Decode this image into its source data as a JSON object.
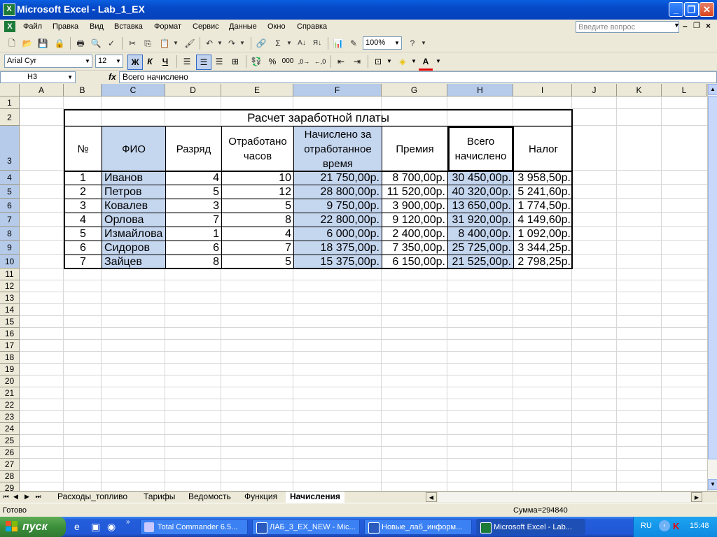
{
  "window": {
    "title": "Microsoft Excel - Lab_1_EX"
  },
  "menu": {
    "items": [
      "Файл",
      "Правка",
      "Вид",
      "Вставка",
      "Формат",
      "Сервис",
      "Данные",
      "Окно",
      "Справка"
    ],
    "ask_placeholder": "Введите вопрос"
  },
  "toolbar": {
    "zoom": "100%"
  },
  "format_toolbar": {
    "font": "Arial Cyr",
    "size": "12",
    "bold": "Ж",
    "italic": "К",
    "underline": "Ч",
    "thousands": "000"
  },
  "formula_bar": {
    "cell_ref": "H3",
    "fx": "fx",
    "content": "Всего начислено"
  },
  "columns": [
    "A",
    "B",
    "C",
    "D",
    "E",
    "F",
    "G",
    "H",
    "I",
    "J",
    "K",
    "L"
  ],
  "rows": [
    "1",
    "2",
    "3",
    "4",
    "5",
    "6",
    "7",
    "8",
    "9",
    "10",
    "11",
    "12",
    "13",
    "14",
    "15",
    "16",
    "17",
    "18",
    "19",
    "20",
    "21",
    "22",
    "23",
    "24",
    "25",
    "26",
    "27",
    "28",
    "29"
  ],
  "sheet": {
    "title": "Расчет заработной платы",
    "headers": {
      "num": "№",
      "fio": "ФИО",
      "razryad": "Разряд",
      "hours": "Отработано часов",
      "accrued": "Начислено за отработанное время",
      "bonus": "Премия",
      "total": "Всего начислено",
      "tax": "Налог"
    },
    "records": [
      {
        "n": "1",
        "name": "Иванов",
        "grade": "4",
        "hours": "10",
        "accrued": "21 750,00р.",
        "bonus": "8 700,00р.",
        "total": "30 450,00р.",
        "tax": "3 958,50р."
      },
      {
        "n": "2",
        "name": "Петров",
        "grade": "5",
        "hours": "12",
        "accrued": "28 800,00р.",
        "bonus": "11 520,00р.",
        "total": "40 320,00р.",
        "tax": "5 241,60р."
      },
      {
        "n": "3",
        "name": "Ковалев",
        "grade": "3",
        "hours": "5",
        "accrued": "9 750,00р.",
        "bonus": "3 900,00р.",
        "total": "13 650,00р.",
        "tax": "1 774,50р."
      },
      {
        "n": "4",
        "name": "Орлова",
        "grade": "7",
        "hours": "8",
        "accrued": "22 800,00р.",
        "bonus": "9 120,00р.",
        "total": "31 920,00р.",
        "tax": "4 149,60р."
      },
      {
        "n": "5",
        "name": "Измайлова",
        "grade": "1",
        "hours": "4",
        "accrued": "6 000,00р.",
        "bonus": "2 400,00р.",
        "total": "8 400,00р.",
        "tax": "1 092,00р."
      },
      {
        "n": "6",
        "name": "Сидоров",
        "grade": "6",
        "hours": "7",
        "accrued": "18 375,00р.",
        "bonus": "7 350,00р.",
        "total": "25 725,00р.",
        "tax": "3 344,25р."
      },
      {
        "n": "7",
        "name": "Зайцев",
        "grade": "8",
        "hours": "5",
        "accrued": "15 375,00р.",
        "bonus": "6 150,00р.",
        "total": "21 525,00р.",
        "tax": "2 798,25р."
      }
    ]
  },
  "sheet_tabs": [
    "Расходы_топливо",
    "Тарифы",
    "Ведомость",
    "Функция",
    "Начисления"
  ],
  "active_tab": "Начисления",
  "status": {
    "ready": "Готово",
    "sum": "Сумма=294840"
  },
  "taskbar": {
    "start": "пуск",
    "tasks": [
      "Total Commander 6.5...",
      "ЛАБ_3_EX_NEW - Mic...",
      "Новые_лаб_информ...",
      "Microsoft Excel - Lab..."
    ],
    "lang": "RU",
    "clock": "15:48"
  }
}
